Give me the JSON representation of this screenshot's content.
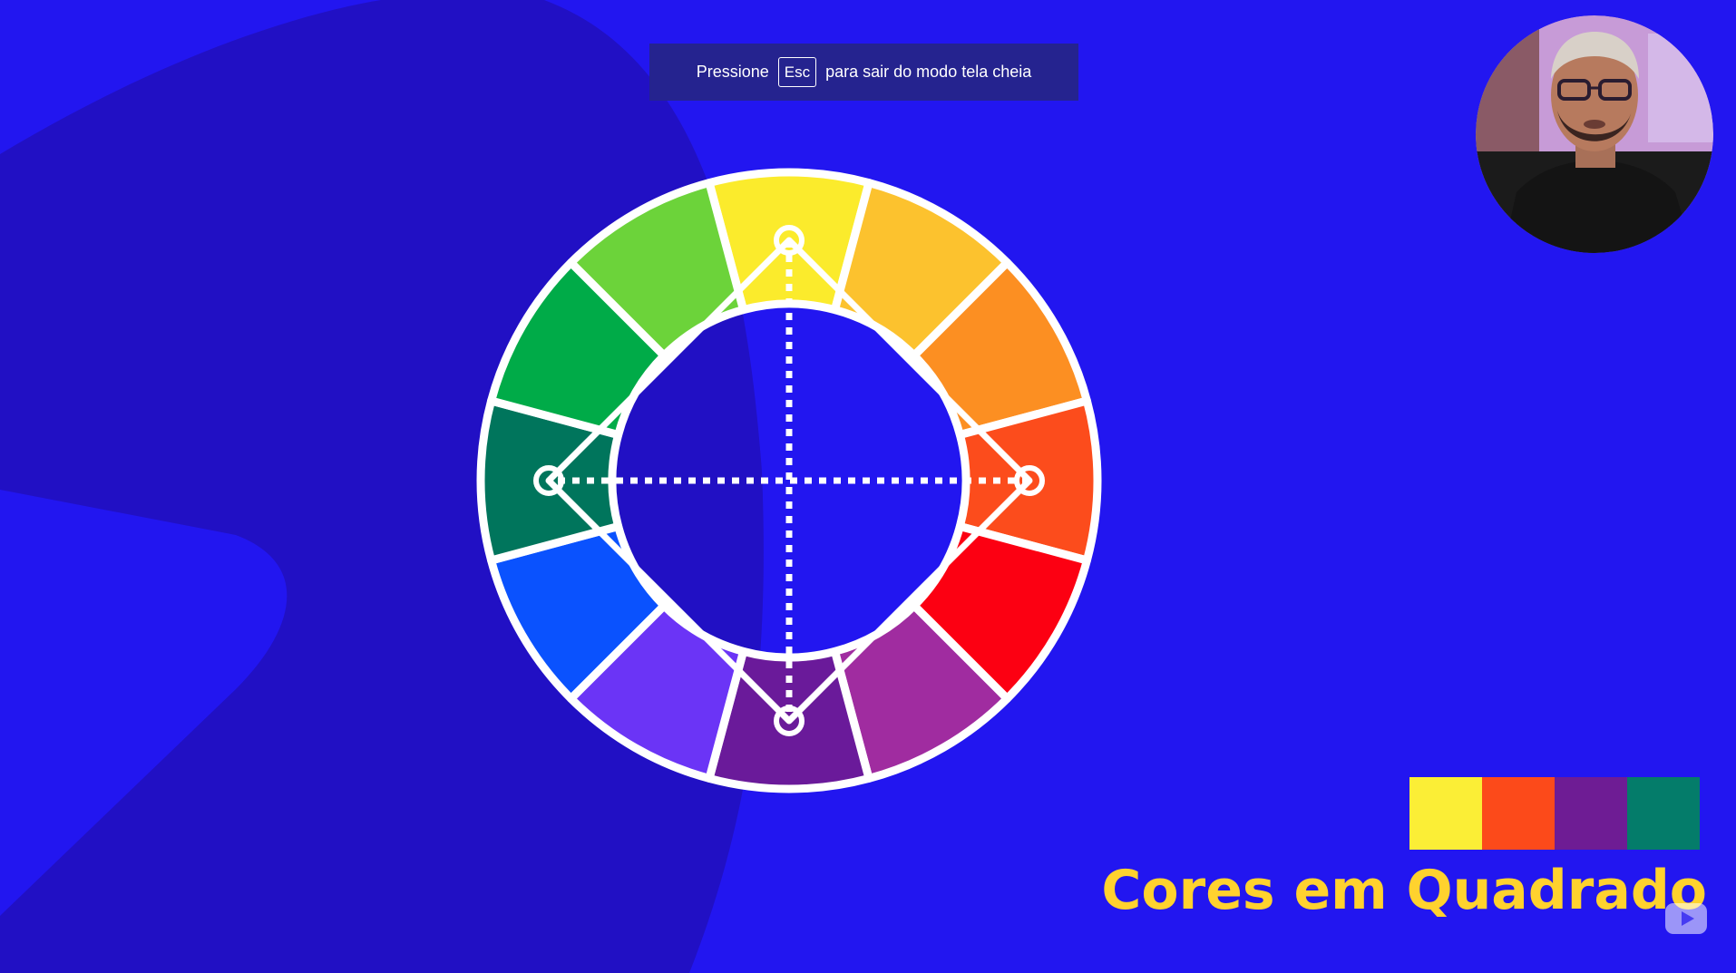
{
  "fullscreen_notice": {
    "prefix": "Pressione",
    "key": "Esc",
    "suffix": "para sair do modo tela cheia"
  },
  "color_wheel": {
    "segments": [
      "#fbeb2c",
      "#fcc22e",
      "#fc8f22",
      "#fc4c1c",
      "#fc0012",
      "#a02ca0",
      "#6a1a9a",
      "#6b34f6",
      "#0a52fe",
      "#00755c",
      "#00ab48",
      "#6cd33a"
    ],
    "scheme": "square",
    "selected_colors": [
      "#fbeb2c",
      "#fc4c1c",
      "#6a1a9a",
      "#00755c"
    ]
  },
  "palette": {
    "swatches": [
      "#fbee36",
      "#fc4a1a",
      "#6e1c94",
      "#047c6a"
    ]
  },
  "title": "Cores em Quadrado",
  "icons": {
    "presenter": "presenter-webcam",
    "watermark": "play-watermark-icon"
  }
}
